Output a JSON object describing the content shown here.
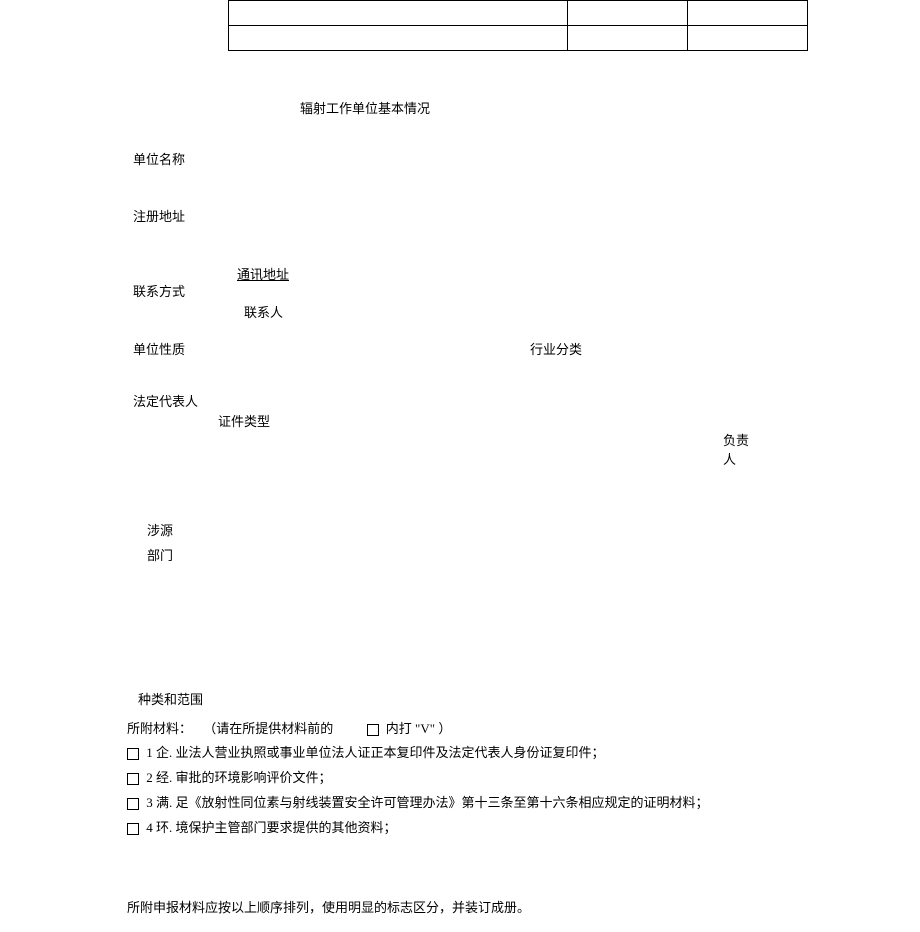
{
  "heading": "辐射工作单位基本情况",
  "fields": {
    "unit_name": "单位名称",
    "registered_address": "注册地址",
    "contact_address": "通讯地址",
    "contact_method": "联系方式",
    "contact_person": "联系人",
    "unit_nature": "单位性质",
    "industry_category": "行业分类",
    "legal_representative": "法定代表人",
    "id_type": "证件类型",
    "responsible_person": "负责人",
    "source_related": "涉源",
    "department": "部门",
    "type_scope": "种类和范围"
  },
  "materials": {
    "intro_prefix": "所附材料：",
    "intro_middle": "（请在所提供材料前的",
    "intro_box_suffix": "内打",
    "intro_checkmark": "\"V\"",
    "intro_end": "）",
    "item1": "1 企. 业法人营业执照或事业单位法人证正本复印件及法定代表人身份证复印件；",
    "item2": "2 经. 审批的环境影响评价文件；",
    "item3": "3 满. 足《放射性同位素与射线装置安全许可管理办法》第十三条至第十六条相应规定的证明材料；",
    "item4": "4 环. 境保护主管部门要求提供的其他资料；"
  },
  "footer": "所附申报材料应按以上顺序排列，使用明显的标志区分，并装订成册。"
}
